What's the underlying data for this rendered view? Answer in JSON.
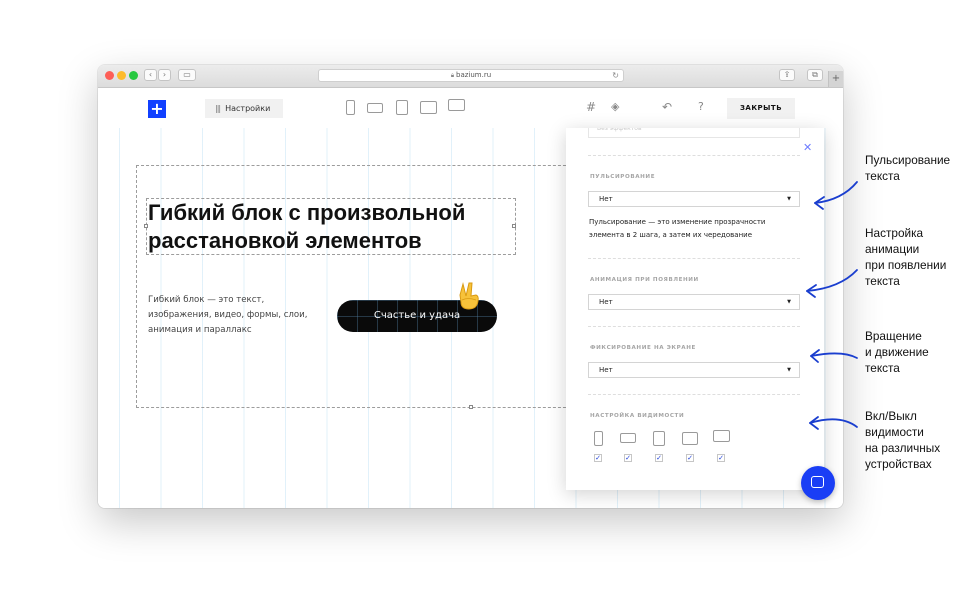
{
  "browser": {
    "url": "bazium.ru"
  },
  "toolbar": {
    "settings_label": "Настройки",
    "close_label": "ЗАКРЫТЬ"
  },
  "block": {
    "heading": "Гибкий блок с произвольной расстановкой элементов",
    "body_lines": [
      "Гибкий блок — это текст,",
      "изображения, видео, формы, слои,",
      "анимация и параллакс"
    ],
    "cta_label": "Счастье и удача"
  },
  "panel": {
    "clipped_select_value": "Без эффектов",
    "pulse": {
      "label": "ПУЛЬСИРОВАНИЕ",
      "value": "Нет",
      "note_lines": [
        "Пульсирование — это изменение прозрачности",
        "элемента в 2 шага, а затем их чередование"
      ]
    },
    "appear": {
      "label": "АНИМАЦИЯ ПРИ ПОЯВЛЕНИИ",
      "value": "Нет"
    },
    "fixed": {
      "label": "ФИКСИРОВАНИЕ НА ЭКРАНЕ",
      "value": "Нет"
    },
    "visibility": {
      "label": "НАСТРОЙКА ВИДИМОСТИ",
      "devices": [
        {
          "icon": "phone-portrait-icon",
          "checked": true
        },
        {
          "icon": "phone-landscape-icon",
          "checked": true
        },
        {
          "icon": "tablet-portrait-icon",
          "checked": true
        },
        {
          "icon": "tablet-landscape-icon",
          "checked": true
        },
        {
          "icon": "desktop-icon",
          "checked": true
        }
      ]
    }
  },
  "annotations": [
    {
      "lines": [
        "Пульсирование",
        "текста"
      ]
    },
    {
      "lines": [
        "Настройка",
        "анимации",
        "при появлении",
        "текста"
      ]
    },
    {
      "lines": [
        "Вращение",
        "и движение",
        "текста"
      ]
    },
    {
      "lines": [
        "Вкл/Выкл",
        "видимости",
        "на различных",
        "устройствах"
      ]
    }
  ],
  "colors": {
    "accent": "#1140ff",
    "annotation_arrow": "#1a3ecf"
  }
}
